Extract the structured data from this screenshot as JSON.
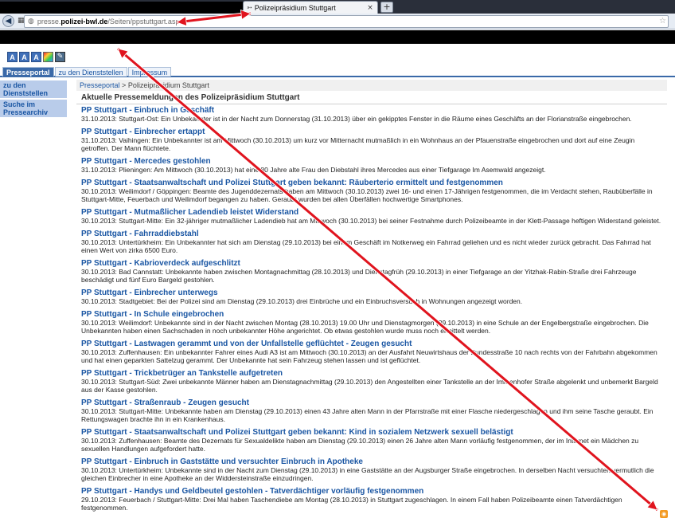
{
  "browser": {
    "tab_title": "Polizeipräsidium Stuttgart",
    "tab_close": "×",
    "newtab": "+",
    "url_host_prefix": "presse.",
    "url_domain": "polizei-bwl.de",
    "url_path": "/Seiten/ppstuttgart.aspx"
  },
  "accessibility": [
    "A",
    "A",
    "A"
  ],
  "site_tabs": [
    "Presseportal",
    "zu den Dienststellen",
    "Impressum"
  ],
  "sidebar": [
    "zu den Dienststellen",
    "Suche im Pressearchiv"
  ],
  "breadcrumb": {
    "root": "Presseportal",
    "sep": ">",
    "current": "Polizeipräsidium Stuttgart"
  },
  "section_title": "Aktuelle Pressemeldungen des Polizeipräsidium Stuttgart",
  "news": [
    {
      "title": "PP Stuttgart - Einbruch in Geschäft",
      "desc": "31.10.2013: Stuttgart-Ost: Ein Unbekannter ist in der Nacht zum Donnerstag (31.10.2013) über ein gekipptes Fenster in die Räume eines Geschäfts an der Florianstraße eingebrochen."
    },
    {
      "title": "PP Stuttgart - Einbrecher ertappt",
      "desc": "31.10.2013: Vaihingen: Ein Unbekannter ist am Mittwoch (30.10.2013) um kurz vor Mitternacht mutmaßlich in ein Wohnhaus an der Pfauenstraße eingebrochen und dort auf eine Zeugin getroffen. Der Mann flüchtete."
    },
    {
      "title": "PP Stuttgart - Mercedes gestohlen",
      "desc": "31.10.2013: Plieningen: Am Mittwoch (30.10.2013) hat eine 80 Jahre alte Frau den Diebstahl ihres Mercedes aus einer Tiefgarage Im Asemwald angezeigt."
    },
    {
      "title": "PP Stuttgart - Staatsanwaltschaft und Polizei Stuttgart geben bekannt: Räuberterio ermittelt und festgenommen",
      "desc": "30.10.2013: Weilimdorf / Göppingen: Beamte des Jugenddezernats haben am Mittwoch (30.10.2013) zwei 16- und einen 17-Jährigen festgenommen, die im Verdacht stehen, Raubüberfälle in Stuttgart-Mitte, Feuerbach und Weilimdorf begangen zu haben. Geraubt wurden bei allen Überfällen hochwertige Smartphones."
    },
    {
      "title": "PP Stuttgart - Mutmaßlicher Ladendieb leistet Widerstand",
      "desc": "30.10.2013: Stuttgart-Mitte: Ein 32-jähriger mutmaßlicher Ladendieb hat am Mittwoch (30.10.2013) bei seiner Festnahme durch Polizeibeamte in der Klett-Passage heftigen Widerstand geleistet."
    },
    {
      "title": "PP Stuttgart - Fahrraddiebstahl",
      "desc": "30.10.2013: Untertürkheim: Ein Unbekannter hat sich am Dienstag (29.10.2013) bei einem Geschäft im Notkerweg ein Fahrrad geliehen und es nicht wieder zurück gebracht. Das Fahrrad hat einen Wert von zirka 6500 Euro."
    },
    {
      "title": "PP Stuttgart - Kabrioverdeck aufgeschlitzt",
      "desc": "30.10.2013: Bad Cannstatt: Unbekannte haben zwischen Montagnachmittag (28.10.2013) und Dienstagfrüh (29.10.2013) in einer Tiefgarage an der Yitzhak-Rabin-Straße drei Fahrzeuge beschädigt und fünf Euro Bargeld gestohlen."
    },
    {
      "title": "PP Stuttgart - Einbrecher unterwegs",
      "desc": "30.10.2013: Stadtgebiet: Bei der Polizei sind am Dienstag (29.10.2013) drei Einbrüche und ein Einbruchsversuch in Wohnungen angezeigt worden."
    },
    {
      "title": "PP Stuttgart - In Schule eingebrochen",
      "desc": "30.10.2013: Weilimdorf: Unbekannte sind in der Nacht zwischen Montag (28.10.2013) 19.00 Uhr und Dienstagmorgen (29.10.2013) in eine Schule an der Engelbergstraße eingebrochen. Die Unbekannten haben einen Sachschaden in noch unbekannter Höhe angerichtet. Ob etwas gestohlen wurde muss noch ermittelt werden."
    },
    {
      "title": "PP Stuttgart - Lastwagen gerammt und von der Unfallstelle geflüchtet - Zeugen gesucht",
      "desc": "30.10.2013: Zuffenhausen: Ein unbekannter Fahrer eines Audi A3 ist am Mittwoch (30.10.2013) an der Ausfahrt Neuwirtshaus der Bundesstraße 10 nach rechts von der Fahrbahn abgekommen und hat einen geparkten Sattelzug gerammt. Der Unbekannte hat sein Fahrzeug stehen lassen und ist geflüchtet."
    },
    {
      "title": "PP Stuttgart - Trickbetrüger an Tankstelle aufgetreten",
      "desc": "30.10.2013: Stuttgart-Süd: Zwei unbekannte Männer haben am Dienstagnachmittag (29.10.2013) den Angestellten einer Tankstelle an der Immenhofer Straße abgelenkt und unbemerkt Bargeld aus der Kasse gestohlen."
    },
    {
      "title": "PP Stuttgart - Straßenraub - Zeugen gesucht",
      "desc": "30.10.2013: Stuttgart-Mitte: Unbekannte haben am Dienstag (29.10.2013) einen 43 Jahre alten Mann in der Pfarrstraße mit einer Flasche niedergeschlagen und ihm seine Tasche geraubt. Ein Rettungswagen brachte ihn in ein Krankenhaus."
    },
    {
      "title": "PP Stuttgart - Staatsanwaltschaft und Polizei Stuttgart geben bekannt: Kind in sozialem Netzwerk sexuell belästigt",
      "desc": "30.10.2013: Zuffenhausen: Beamte des Dezernats für Sexualdelikte haben am Dienstag (29.10.2013) einen 26 Jahre alten Mann vorläufig festgenommen, der im Internet ein Mädchen zu sexuellen Handlungen aufgefordert hatte."
    },
    {
      "title": "PP Stuttgart - Einbruch in Gaststätte und versuchter Einbruch in Apotheke",
      "desc": "30.10.2013: Untertürkheim: Unbekannte sind in der Nacht zum Dienstag (29.10.2013) in eine Gaststätte an der Augsburger Straße eingebrochen. In derselben Nacht versuchten vermutlich die gleichen Einbrecher in eine Apotheke an der Widdersteinstraße einzudringen."
    },
    {
      "title": "PP Stuttgart - Handys und Geldbeutel gestohlen - Tatverdächtiger vorläufig festgenommen",
      "desc": "29.10.2013: Feuerbach / Stuttgart-Mitte: Drei Mal haben Taschendiebe am Montag (28.10.2013) in Stuttgart zugeschlagen. In einem Fall haben Polizeibeamte einen Tatverdächtigen festgenommen."
    }
  ],
  "annotation_color": "#e0141e"
}
